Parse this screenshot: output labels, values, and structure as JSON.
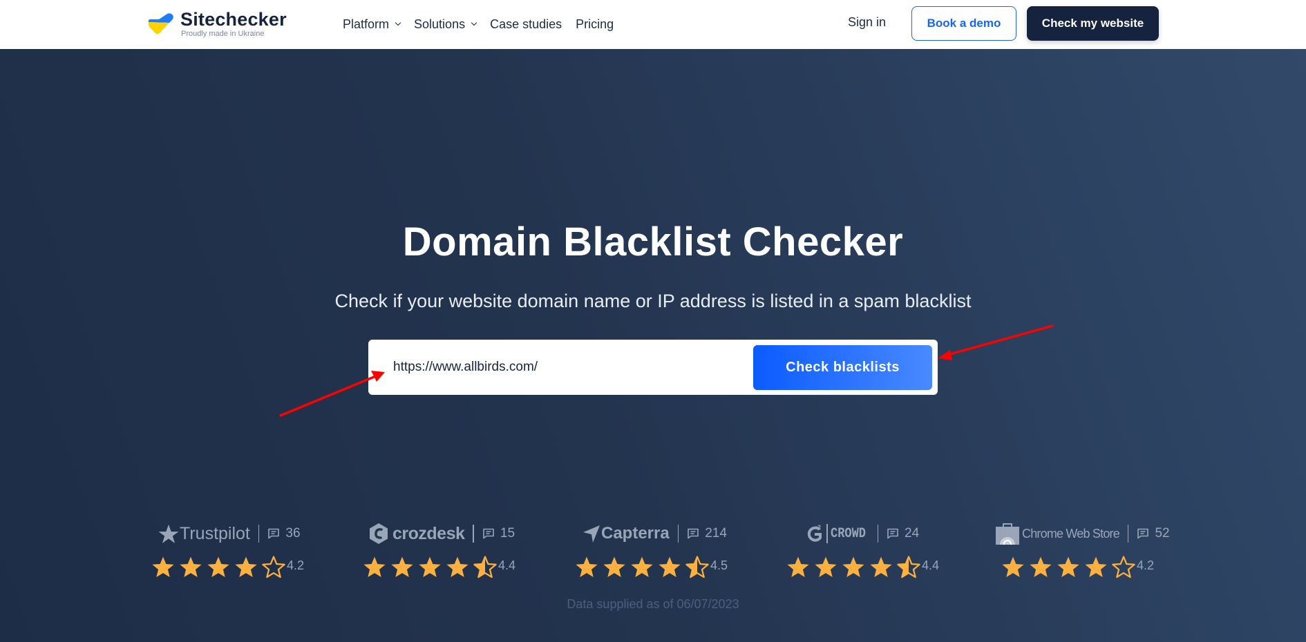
{
  "header": {
    "logo": {
      "name": "Sitechecker",
      "tagline": "Proudly made in Ukraine",
      "icon": "ukraine-heart-check-icon",
      "colors": {
        "top": "#1f7cf5",
        "bottom": "#ffd200"
      }
    },
    "nav": [
      {
        "label": "Platform",
        "has_dropdown": true
      },
      {
        "label": "Solutions",
        "has_dropdown": true
      },
      {
        "label": "Case studies",
        "has_dropdown": false
      },
      {
        "label": "Pricing",
        "has_dropdown": false
      }
    ],
    "sign_in": "Sign in",
    "book_demo": "Book a demo",
    "check_website": "Check my website"
  },
  "hero": {
    "title": "Domain Blacklist Checker",
    "subtitle": "Check if your website domain name or IP address is listed in a spam blacklist",
    "url_input": {
      "value": "https://www.allbirds.com/",
      "placeholder": ""
    },
    "submit_label": "Check blacklists",
    "annotations": [
      "red-arrow-pointing-at-url-input",
      "red-arrow-pointing-at-check-button"
    ]
  },
  "ratings": [
    {
      "brand": "Trustpilot",
      "icon": "trustpilot-star-icon",
      "reviews": "36",
      "score": "4.2",
      "stars": 4.2
    },
    {
      "brand": "crozdesk",
      "icon": "crozdesk-logo-icon",
      "reviews": "15",
      "score": "4.4",
      "stars": 4.4
    },
    {
      "brand": "Capterra",
      "icon": "capterra-arrow-icon",
      "reviews": "214",
      "score": "4.5",
      "stars": 4.5
    },
    {
      "brand": "CROWD",
      "icon": "g2-logo-icon",
      "reviews": "24",
      "score": "4.4",
      "stars": 4.4
    },
    {
      "brand": "Chrome Web Store",
      "icon": "chrome-web-store-icon",
      "reviews": "52",
      "score": "4.2",
      "stars": 4.2
    }
  ],
  "data_note": "Data supplied as of 06/07/2023",
  "colors": {
    "brand_dark": "#16233f",
    "accent_blue": "#1566f5",
    "star": "#fbb040",
    "annotation_red": "#ff0000"
  }
}
